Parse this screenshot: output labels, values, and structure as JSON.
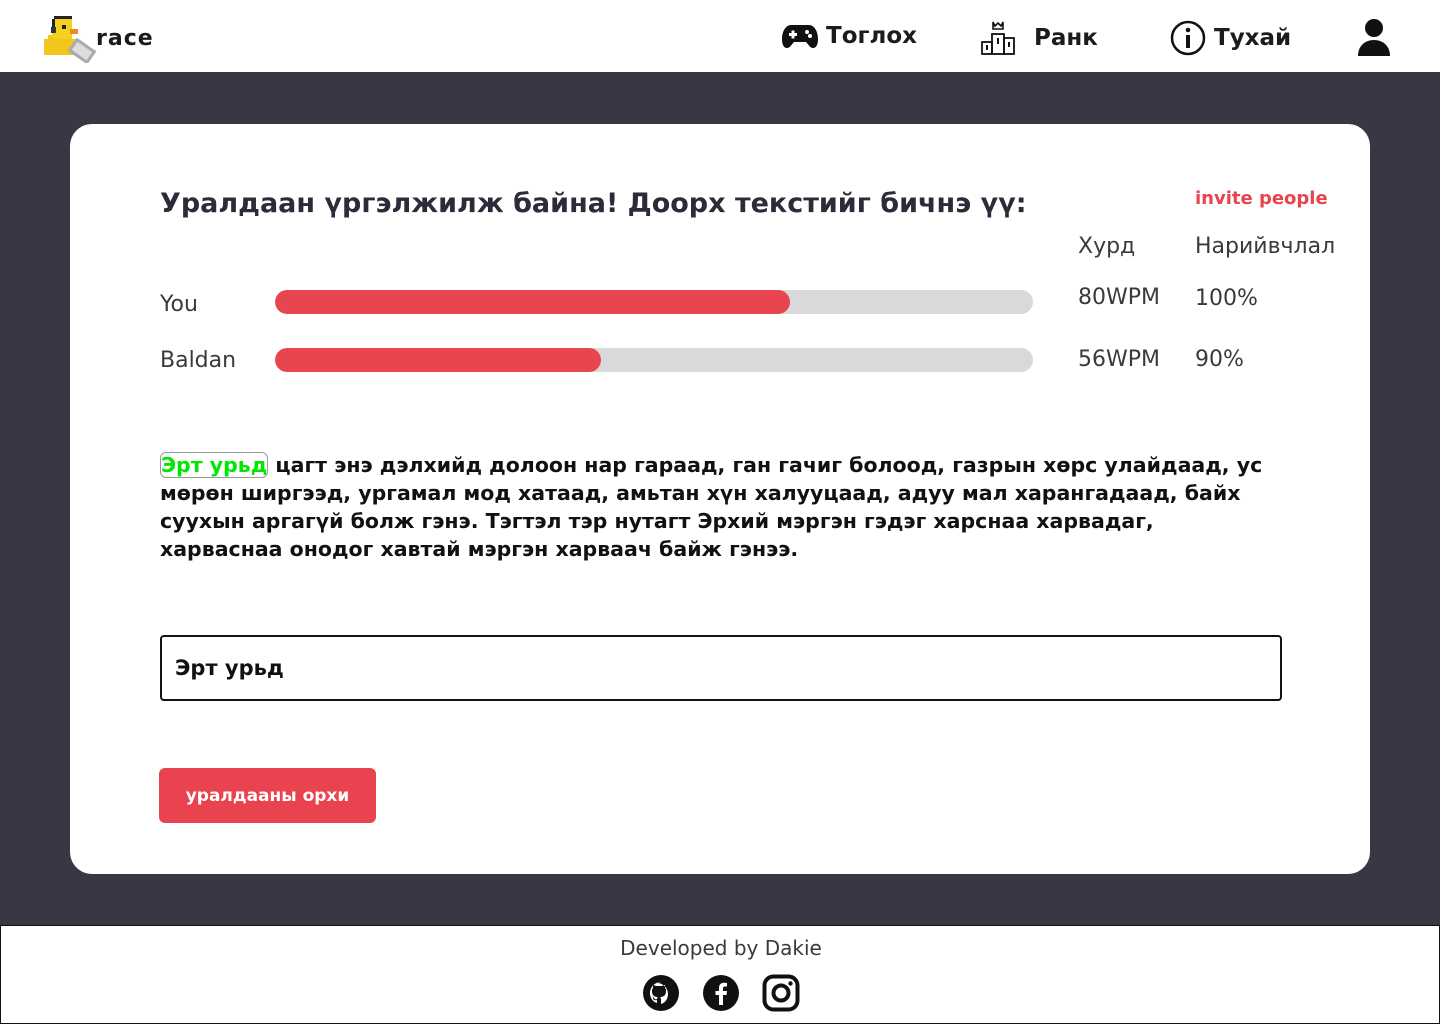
{
  "header": {
    "logo_text": "race",
    "nav": {
      "play_label": "Тоглох",
      "rank_label": "Ранк",
      "about_label": "Тухай"
    }
  },
  "race": {
    "title": "Уралдаан үргэлжилж байна! Доорх текстийг бичнэ үү:",
    "invite_label": "invite people",
    "columns": {
      "speed": "Хурд",
      "accuracy": "Нарийвчлал"
    },
    "racers": [
      {
        "name": "You",
        "progress": 0.68,
        "speed": "80WPM",
        "accuracy": "100%"
      },
      {
        "name": "Baldan",
        "progress": 0.43,
        "speed": "56WPM",
        "accuracy": "90%"
      }
    ],
    "passage_typed": "Эрт урьд",
    "passage_rest": " цагт энэ дэлхийд долоон нар гараад, ган гачиг болоод, газрын хөрс улайдаад, ус мөрөн ширгээд, ургамал мод хатаад, амьтан хүн халууцаад, адуу мал харангадаад, байх суухын аргагүй болж гэнэ. Тэгтэл тэр нутагт Эрхий мэргэн гэдэг харснаа харвадаг, харваснаа онодог хавтай мэргэн харваач байж гэнээ.",
    "input_value": "Эрт урьд",
    "leave_label": "уралдааны орхи"
  },
  "footer": {
    "developed_by": "Developed by Dakie"
  },
  "colors": {
    "accent": "#e8434f",
    "background": "#3a3745",
    "typed": "#00e800",
    "track": "#d9d9d9"
  }
}
